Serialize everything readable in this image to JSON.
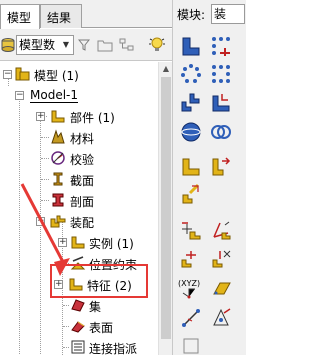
{
  "left_tabs": [
    "模型",
    "结果"
  ],
  "toolbar": {
    "combo_value": "模型数"
  },
  "tree": {
    "root": "模型 (1)",
    "model": "Model-1",
    "items": [
      {
        "label": "部件 (1)",
        "icon": "part-icon"
      },
      {
        "label": "材料",
        "icon": "material-icon"
      },
      {
        "label": "校验",
        "icon": "calibration-icon"
      },
      {
        "label": "截面",
        "icon": "section-icon"
      },
      {
        "label": "剖面",
        "icon": "profile-icon"
      },
      {
        "label": "装配",
        "icon": "assembly-icon"
      },
      {
        "label": "实例 (1)",
        "icon": "instance-icon"
      },
      {
        "label": "位置约束",
        "icon": "position-constraint-icon"
      },
      {
        "label": "特征 (2)",
        "icon": "feature-icon"
      },
      {
        "label": "集",
        "icon": "set-icon"
      },
      {
        "label": "表面",
        "icon": "surface-icon"
      },
      {
        "label": "连接指派",
        "icon": "connector-assignment-icon"
      }
    ]
  },
  "right": {
    "module_label": "模块:",
    "module_value": "装"
  },
  "colors": {
    "highlight": "#e53935",
    "icon_blue": "#2f5fb8",
    "icon_yellow": "#e2b418"
  }
}
